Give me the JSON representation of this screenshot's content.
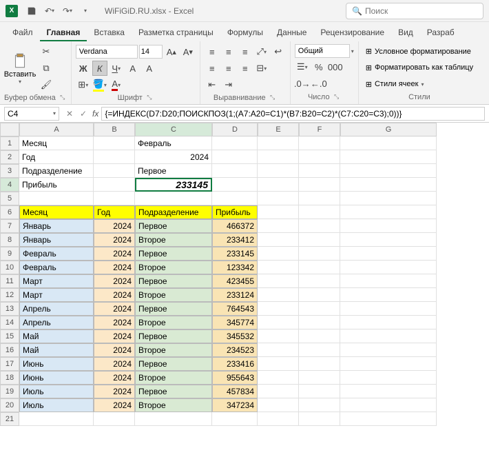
{
  "titlebar": {
    "filename": "WiFiGiD.RU.xlsx - Excel",
    "search_placeholder": "Поиск"
  },
  "tabs": [
    "Файл",
    "Главная",
    "Вставка",
    "Разметка страницы",
    "Формулы",
    "Данные",
    "Рецензирование",
    "Вид",
    "Разраб"
  ],
  "active_tab": 1,
  "ribbon": {
    "clipboard": {
      "paste": "Вставить",
      "label": "Буфер обмена"
    },
    "font": {
      "name": "Verdana",
      "size": "14",
      "label": "Шрифт"
    },
    "align": {
      "label": "Выравнивание"
    },
    "number": {
      "format": "Общий",
      "label": "Число"
    },
    "styles": {
      "cond": "Условное форматирование",
      "table": "Форматировать как таблицу",
      "cell": "Стили ячеек",
      "label": "Стили"
    }
  },
  "formula": {
    "namebox": "C4",
    "content": "{=ИНДЕКС(D7:D20;ПОИСКПОЗ(1;(A7:A20=C1)*(B7:B20=C2)*(C7:C20=C3);0))}"
  },
  "cols": [
    "A",
    "B",
    "C",
    "D",
    "E",
    "F",
    "G"
  ],
  "top_rows": [
    {
      "n": 1,
      "a": "Месяц",
      "c": "Февраль"
    },
    {
      "n": 2,
      "a": "Год",
      "c": "2024"
    },
    {
      "n": 3,
      "a": "Подразделение",
      "c": "Первое"
    },
    {
      "n": 4,
      "a": "Прибыль",
      "c": "233145"
    }
  ],
  "header_row": {
    "n": 6,
    "cells": [
      "Месяц",
      "Год",
      "Подразделение",
      "Прибыль"
    ]
  },
  "data_rows": [
    {
      "n": 7,
      "m": "Январь",
      "y": "2024",
      "p": "Первое",
      "v": "466372"
    },
    {
      "n": 8,
      "m": "Январь",
      "y": "2024",
      "p": "Второе",
      "v": "233412"
    },
    {
      "n": 9,
      "m": "Февраль",
      "y": "2024",
      "p": "Первое",
      "v": "233145"
    },
    {
      "n": 10,
      "m": "Февраль",
      "y": "2024",
      "p": "Второе",
      "v": "123342"
    },
    {
      "n": 11,
      "m": "Март",
      "y": "2024",
      "p": "Первое",
      "v": "423455"
    },
    {
      "n": 12,
      "m": "Март",
      "y": "2024",
      "p": "Второе",
      "v": "233124"
    },
    {
      "n": 13,
      "m": "Апрель",
      "y": "2024",
      "p": "Первое",
      "v": "764543"
    },
    {
      "n": 14,
      "m": "Апрель",
      "y": "2024",
      "p": "Второе",
      "v": "345774"
    },
    {
      "n": 15,
      "m": "Май",
      "y": "2024",
      "p": "Первое",
      "v": "345532"
    },
    {
      "n": 16,
      "m": "Май",
      "y": "2024",
      "p": "Второе",
      "v": "234523"
    },
    {
      "n": 17,
      "m": "Июнь",
      "y": "2024",
      "p": "Первое",
      "v": "233416"
    },
    {
      "n": 18,
      "m": "Июнь",
      "y": "2024",
      "p": "Второе",
      "v": "955643"
    },
    {
      "n": 19,
      "m": "Июль",
      "y": "2024",
      "p": "Первое",
      "v": "457834"
    },
    {
      "n": 20,
      "m": "Июль",
      "y": "2024",
      "p": "Второе",
      "v": "347234"
    }
  ]
}
